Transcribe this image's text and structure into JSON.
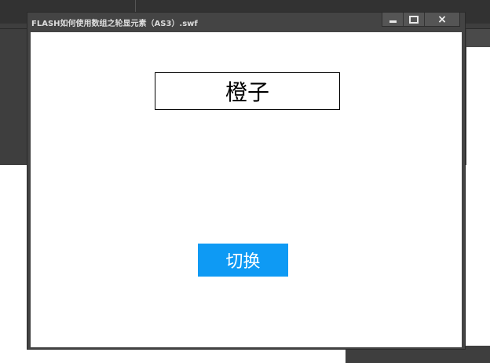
{
  "window": {
    "title": "FLASH如何使用数组之轮显元素（AS3）.swf",
    "controls": {
      "minimize": "minimize-icon",
      "maximize": "maximize-icon",
      "close": "×"
    }
  },
  "stage": {
    "display_text": "橙子",
    "switch_button_label": "切换"
  },
  "colors": {
    "titlebar": "#444444",
    "button_accent": "#0e9af4",
    "stage_background": "#ffffff"
  }
}
